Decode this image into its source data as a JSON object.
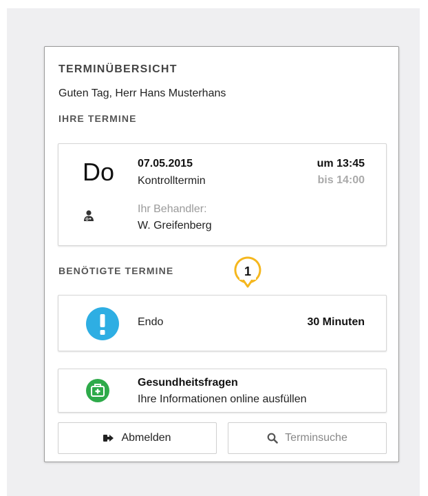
{
  "header": {
    "title": "TERMINÜBERSICHT",
    "greeting": "Guten Tag, Herr Hans Musterhans"
  },
  "appointments": {
    "section_label": "IHRE TERMINE",
    "items": [
      {
        "weekday": "Do",
        "date": "07.05.2015",
        "type": "Kontrolltermin",
        "time_from": "um 13:45",
        "time_to": "bis 14:00",
        "practitioner_label": "Ihr Behandler:",
        "practitioner_name": "W. Greifenberg"
      }
    ]
  },
  "marker": {
    "number": "1",
    "color": "#f5b71e"
  },
  "required": {
    "section_label": "BENÖTIGTE TERMINE",
    "items": [
      {
        "name": "Endo",
        "duration": "30 Minuten",
        "icon": "exclamation-icon",
        "icon_color": "#2eaee3"
      }
    ]
  },
  "health_questions": {
    "title": "Gesundheitsfragen",
    "subtitle": "Ihre Informationen online ausfüllen",
    "icon": "first-aid-kit-icon",
    "icon_color": "#2eaa4a"
  },
  "actions": {
    "logout_label": "Abmelden",
    "search_label": "Terminsuche"
  }
}
